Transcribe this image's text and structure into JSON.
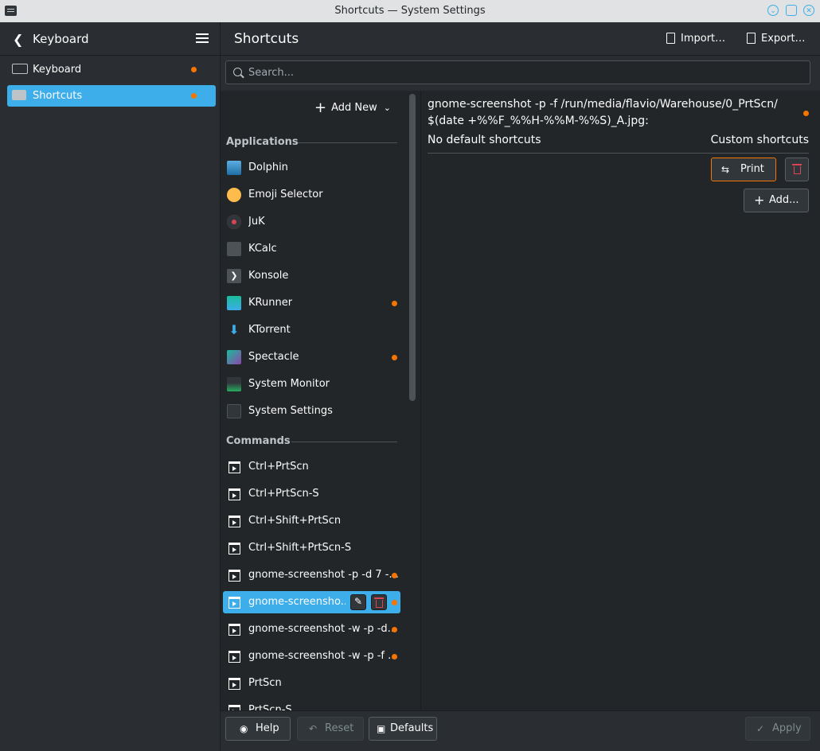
{
  "window": {
    "title": "Shortcuts — System Settings"
  },
  "sidebar": {
    "back_label": "Keyboard",
    "items": [
      {
        "label": "Keyboard",
        "modified": true,
        "icon": "keyboard-icon"
      },
      {
        "label": "Shortcuts",
        "modified": true,
        "icon": "shortcuts-icon",
        "selected": true
      }
    ]
  },
  "header": {
    "title": "Shortcuts",
    "import_label": "Import…",
    "export_label": "Export…"
  },
  "search": {
    "placeholder": "Search..."
  },
  "list": {
    "add_new_label": "Add New",
    "applications_heading": "Applications",
    "applications": [
      {
        "label": "Dolphin",
        "icon": "dolphin-icon",
        "modified": false
      },
      {
        "label": "Emoji Selector",
        "icon": "emoji-icon",
        "modified": false
      },
      {
        "label": "JuK",
        "icon": "juk-icon",
        "modified": false
      },
      {
        "label": "KCalc",
        "icon": "kcalc-icon",
        "modified": false
      },
      {
        "label": "Konsole",
        "icon": "konsole-icon",
        "modified": false
      },
      {
        "label": "KRunner",
        "icon": "krunner-icon",
        "modified": true
      },
      {
        "label": "KTorrent",
        "icon": "ktorrent-icon",
        "modified": false
      },
      {
        "label": "Spectacle",
        "icon": "spectacle-icon",
        "modified": true
      },
      {
        "label": "System Monitor",
        "icon": "system-monitor-icon",
        "modified": false
      },
      {
        "label": "System Settings",
        "icon": "system-settings-icon",
        "modified": false
      }
    ],
    "commands_heading": "Commands",
    "commands": [
      {
        "label": "Ctrl+PrtScn",
        "modified": false
      },
      {
        "label": "Ctrl+PrtScn-S",
        "modified": false
      },
      {
        "label": "Ctrl+Shift+PrtScn",
        "modified": false
      },
      {
        "label": "Ctrl+Shift+PrtScn-S",
        "modified": false
      },
      {
        "label": "gnome-screenshot -p -d 7 -...",
        "modified": true
      },
      {
        "label": "gnome-screensho...",
        "modified": true,
        "selected": true
      },
      {
        "label": "gnome-screenshot -w -p -d...",
        "modified": true
      },
      {
        "label": "gnome-screenshot -w -p -f ...",
        "modified": true
      },
      {
        "label": "PrtScn",
        "modified": false
      },
      {
        "label": "PrtScn-S",
        "modified": false
      }
    ]
  },
  "detail": {
    "command": "gnome-screenshot -p -f /run/media/flavio/Warehouse/0_PrtScn/$(date +%%F_%%H-%%M-%%S)_A.jpg:",
    "no_default_label": "No default shortcuts",
    "custom_label": "Custom shortcuts",
    "shortcut_key": "Print",
    "add_label": "Add..."
  },
  "footer": {
    "help_label": "Help",
    "reset_label": "Reset",
    "defaults_label": "Defaults",
    "apply_label": "Apply"
  },
  "colors": {
    "accent": "#3daee9",
    "modified_dot": "#f67400",
    "background": "#2a2e32"
  }
}
